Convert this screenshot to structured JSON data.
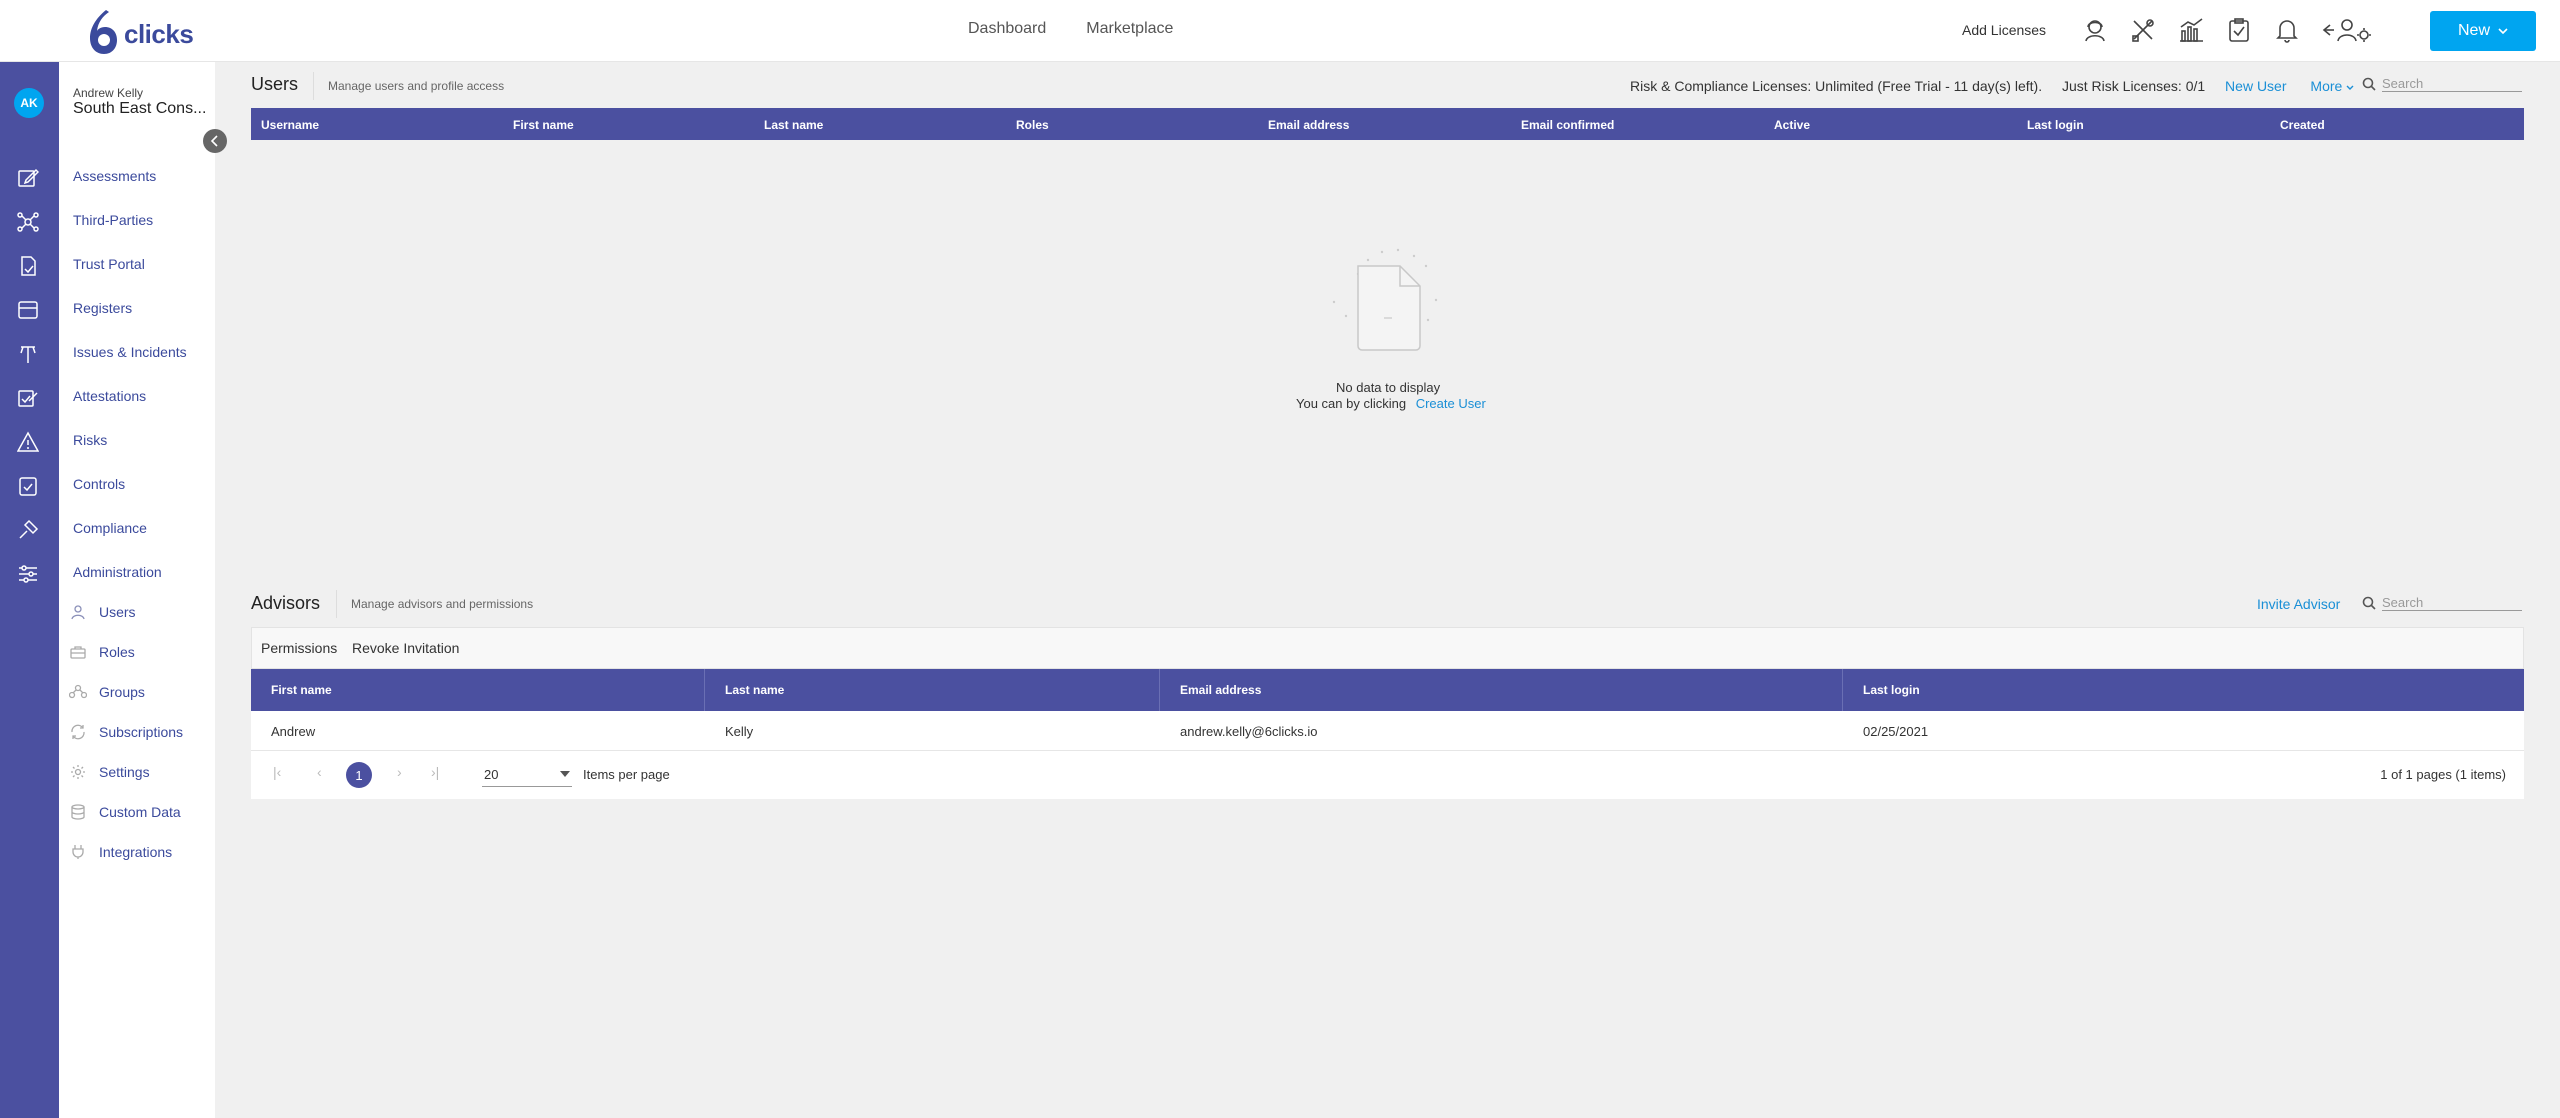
{
  "brand": {
    "logo_text": "clicks",
    "accent": "#4b50a0",
    "button_color": "#00a5f0"
  },
  "topnav": {
    "dashboard": "Dashboard",
    "marketplace": "Marketplace"
  },
  "header": {
    "add_licenses": "Add Licenses",
    "new_button": "New"
  },
  "user": {
    "initials": "AK",
    "name": "Andrew Kelly",
    "org": "South East Cons..."
  },
  "sidebar": {
    "items": [
      "Assessments",
      "Third-Parties",
      "Trust Portal",
      "Registers",
      "Issues & Incidents",
      "Attestations",
      "Risks",
      "Controls",
      "Compliance",
      "Administration"
    ],
    "admin_items": [
      "Users",
      "Roles",
      "Groups",
      "Subscriptions",
      "Settings",
      "Custom Data",
      "Integrations"
    ]
  },
  "users": {
    "title": "Users",
    "desc": "Manage users and profile access",
    "licenses_text": "Risk & Compliance Licenses: Unlimited (Free Trial - 11 day(s) left).",
    "risk_licenses": "Just Risk Licenses: 0/1",
    "new_user": "New User",
    "more": "More",
    "search_placeholder": "Search",
    "columns": [
      "Username",
      "First name",
      "Last name",
      "Roles",
      "Email address",
      "Email confirmed",
      "Active",
      "Last login",
      "Created"
    ],
    "empty_title": "No data to display",
    "empty_prompt": "You can by clicking",
    "create_user": "Create User"
  },
  "advisors": {
    "title": "Advisors",
    "desc": "Manage advisors and permissions",
    "invite": "Invite Advisor",
    "search_placeholder": "Search",
    "toolbar": {
      "permissions": "Permissions",
      "revoke": "Revoke Invitation"
    },
    "columns": [
      "First name",
      "Last name",
      "Email address",
      "Last login"
    ],
    "rows": [
      {
        "first": "Andrew",
        "last": "Kelly",
        "email": "andrew.kelly@6clicks.io",
        "login": "02/25/2021"
      }
    ],
    "pager": {
      "current": "1",
      "per_page": "20",
      "per_page_label": "Items per page",
      "info": "1 of 1 pages (1 items)"
    }
  }
}
